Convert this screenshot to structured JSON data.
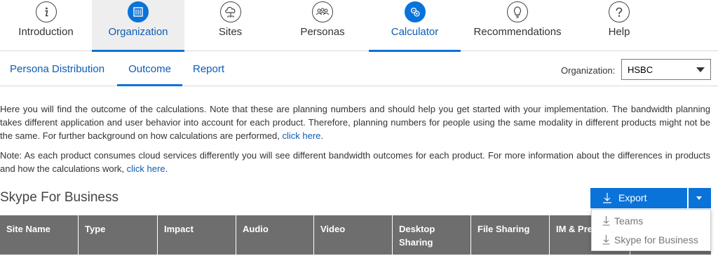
{
  "nav": {
    "items": [
      {
        "label": "Introduction",
        "icon": "info-icon"
      },
      {
        "label": "Organization",
        "icon": "building-icon"
      },
      {
        "label": "Sites",
        "icon": "cloud-network-icon"
      },
      {
        "label": "Personas",
        "icon": "people-group-icon"
      },
      {
        "label": "Calculator",
        "icon": "calculator-icon"
      },
      {
        "label": "Recommendations",
        "icon": "lightbulb-icon"
      },
      {
        "label": "Help",
        "icon": "question-icon"
      }
    ],
    "selected": "Organization",
    "accent_color": "#0a73d9"
  },
  "subtabs": {
    "items": [
      {
        "label": "Persona Distribution"
      },
      {
        "label": "Outcome"
      },
      {
        "label": "Report"
      }
    ],
    "active": "Outcome"
  },
  "organization": {
    "label": "Organization:",
    "value": "HSBC"
  },
  "intro": {
    "text": "Here you will find the outcome of the calculations. Note that these are planning numbers and should help you get started with your implementation. The bandwidth planning takes different application and user behavior into account for each product. Therefore, planning numbers for people using the same modality in different products might not be the same. For further background on how calculations are performed, ",
    "link": "click here",
    "suffix": "."
  },
  "note": {
    "text": "Note: As each product consumes cloud services differently you will see different bandwidth outcomes for each product. For more information about the differences in products and how the calculations work, ",
    "link": "click here",
    "suffix": "."
  },
  "section": {
    "title": "Skype For Business"
  },
  "export": {
    "label": "Export",
    "menu": [
      {
        "label": "Teams"
      },
      {
        "label": "Skype for Business"
      }
    ]
  },
  "table": {
    "headers": [
      {
        "label": "Site Name"
      },
      {
        "label": "Type"
      },
      {
        "label": "Impact"
      },
      {
        "label": "Audio"
      },
      {
        "label": "Video"
      },
      {
        "label": "Desktop Sharing"
      },
      {
        "label": "File Sharing"
      },
      {
        "label": "IM & Presence"
      }
    ],
    "header_color": "#6e6e6e"
  }
}
